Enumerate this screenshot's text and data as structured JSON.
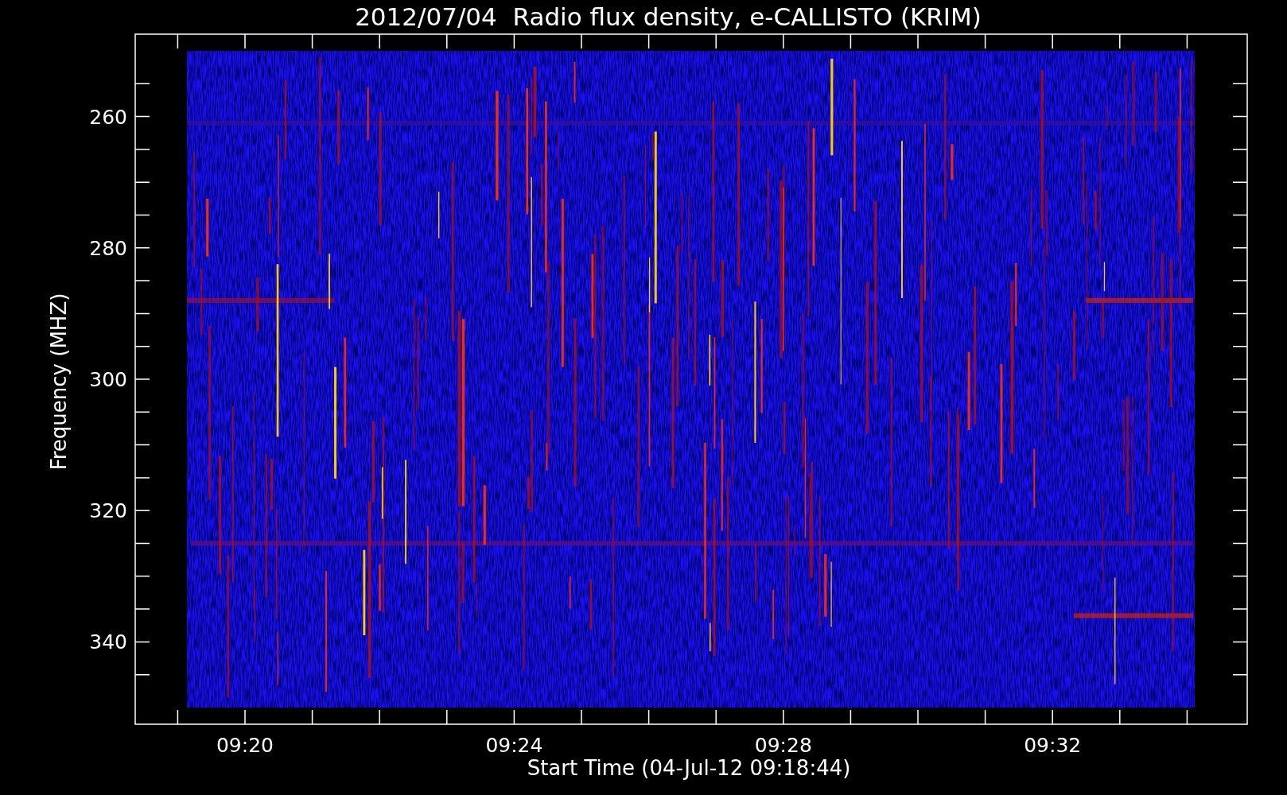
{
  "chart": {
    "title": "2012/07/04  Radio flux density, e-CALLISTO (KRIM)",
    "ylabel": "Frequency (MHZ)",
    "xlabel": "Start Time (04-Jul-12 09:18:44)",
    "x_tick_labels": [
      "09:20",
      "09:24",
      "09:28",
      "09:32"
    ],
    "y_tick_labels": [
      "260",
      "280",
      "300",
      "320",
      "340"
    ]
  }
}
